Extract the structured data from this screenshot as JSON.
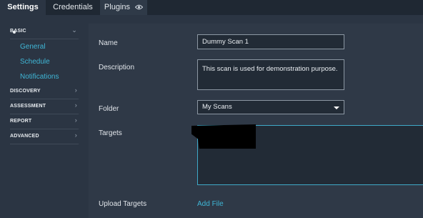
{
  "tabs": [
    {
      "label": "Settings"
    },
    {
      "label": "Credentials"
    },
    {
      "label": "Plugins"
    }
  ],
  "sidebar": {
    "sections": [
      {
        "label": "BASIC",
        "expanded": true
      },
      {
        "label": "DISCOVERY"
      },
      {
        "label": "ASSESSMENT"
      },
      {
        "label": "REPORT"
      },
      {
        "label": "ADVANCED"
      }
    ],
    "basic_items": [
      {
        "label": "General",
        "selected": true
      },
      {
        "label": "Schedule"
      },
      {
        "label": "Notifications"
      }
    ]
  },
  "form": {
    "name_label": "Name",
    "name_value": "Dummy Scan 1",
    "description_label": "Description",
    "description_value": "This scan is used for demonstration purpose.",
    "folder_label": "Folder",
    "folder_value": "My Scans",
    "targets_label": "Targets",
    "upload_label": "Upload Targets",
    "add_file_label": "Add File"
  },
  "colors": {
    "accent": "#3fb6d6",
    "background": "#2b3543",
    "panel": "#2f3947",
    "input_bg": "#222b36"
  }
}
